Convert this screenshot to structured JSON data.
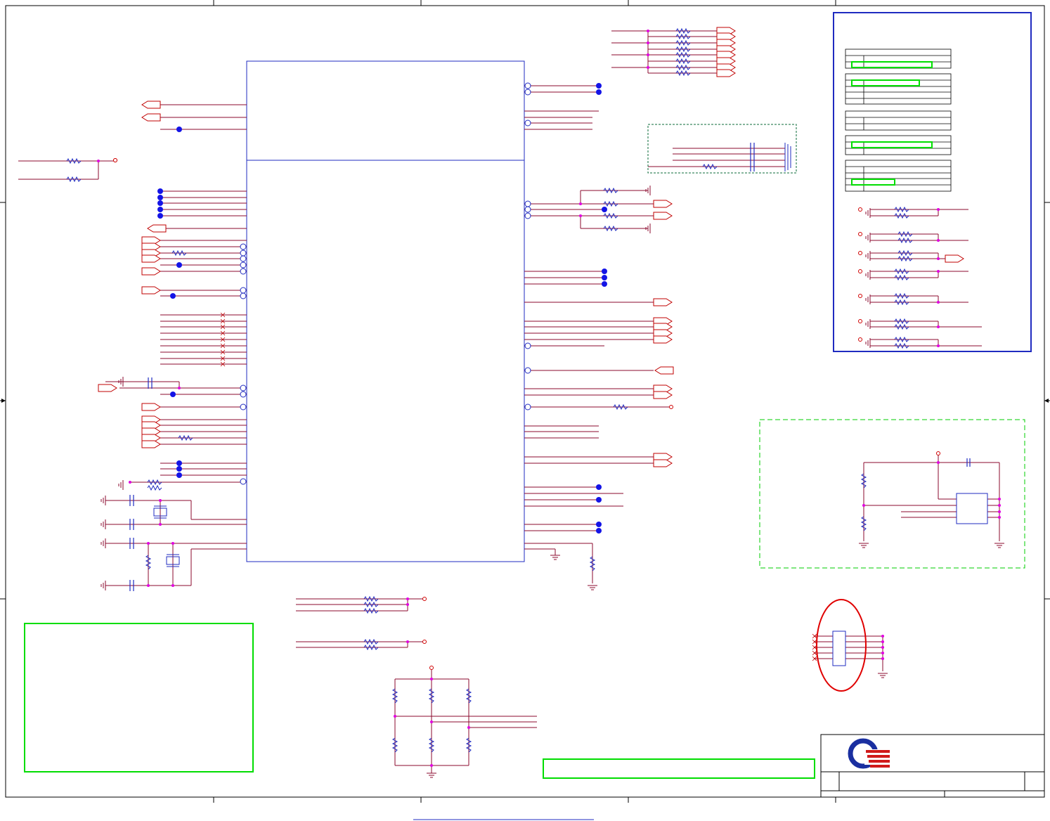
{
  "sheet": {
    "border_color": "#000000",
    "wire_color": "#8b0a2e",
    "bus_color": "#1f2bc0",
    "junction_color": "#1414e6",
    "node_color": "#e000e0",
    "highlight_color": "#00dd00",
    "marker_color": "#e00000"
  },
  "components": {
    "main_ic": {
      "name": "cpu-ic-block"
    },
    "logo": {
      "icon": "company-logo-icon"
    },
    "markers": {
      "icon": "red-ellipse-marker"
    }
  }
}
